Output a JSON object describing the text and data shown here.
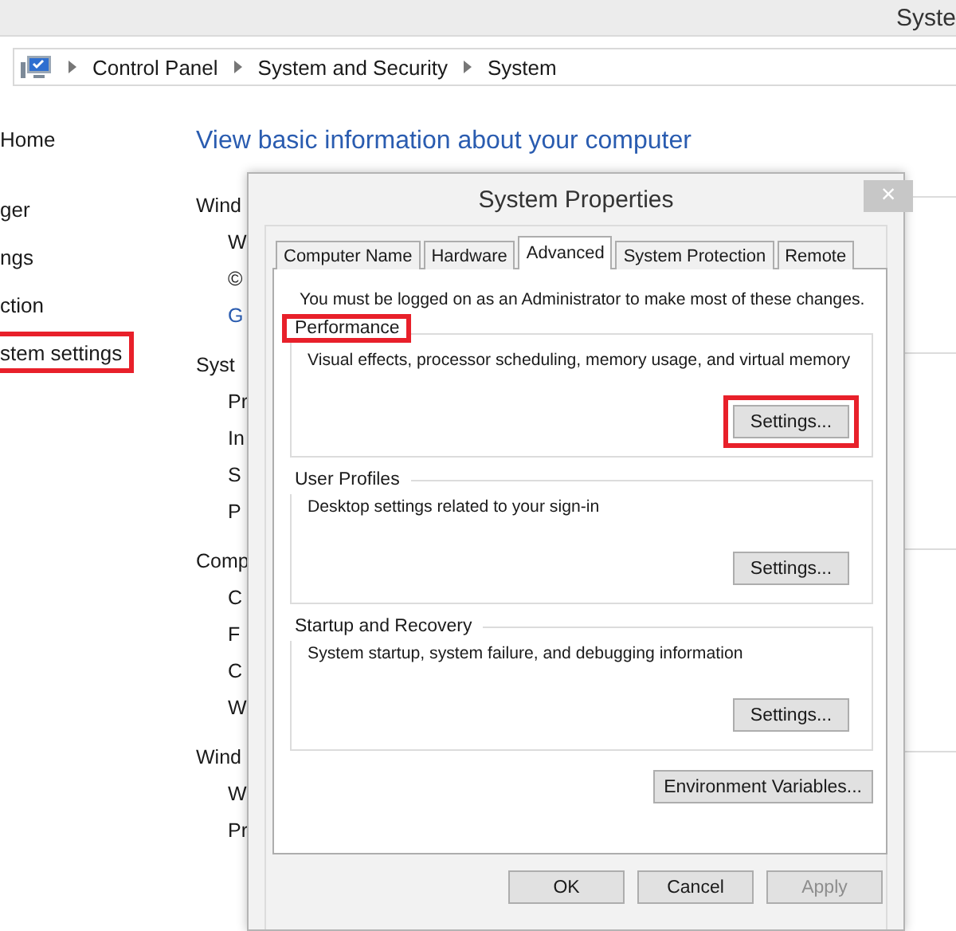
{
  "window": {
    "title": "Syste"
  },
  "breadcrumb": [
    "Control Panel",
    "System and Security",
    "System"
  ],
  "sidebar": {
    "items": [
      {
        "label": "Home",
        "highlighted": false
      },
      {
        "label": "ger",
        "highlighted": false
      },
      {
        "label": "ngs",
        "highlighted": false
      },
      {
        "label": "ction",
        "highlighted": false
      },
      {
        "label": "stem settings",
        "highlighted": true
      }
    ]
  },
  "main": {
    "heading": "View basic information about your computer",
    "lines": [
      {
        "text": "Wind",
        "kind": "heading"
      },
      {
        "text": "W",
        "kind": "item"
      },
      {
        "text": "©",
        "kind": "item"
      },
      {
        "text": "G",
        "kind": "link"
      },
      {
        "text": "Syst",
        "kind": "heading"
      },
      {
        "text": "Pr",
        "kind": "item"
      },
      {
        "text": "In",
        "kind": "item"
      },
      {
        "text": "S",
        "kind": "item"
      },
      {
        "text": "P",
        "kind": "item"
      },
      {
        "text": "Comp",
        "kind": "heading"
      },
      {
        "text": "C",
        "kind": "item"
      },
      {
        "text": "F",
        "kind": "item"
      },
      {
        "text": "C",
        "kind": "item"
      },
      {
        "text": "W",
        "kind": "item"
      },
      {
        "text": "Wind",
        "kind": "heading"
      },
      {
        "text": "W",
        "kind": "item"
      },
      {
        "text": "Pr",
        "kind": "item"
      }
    ]
  },
  "dialog": {
    "title": "System Properties",
    "close": "×",
    "tabs": [
      {
        "label": "Computer Name",
        "selected": false
      },
      {
        "label": "Hardware",
        "selected": false
      },
      {
        "label": "Advanced",
        "selected": true
      },
      {
        "label": "System Protection",
        "selected": false
      },
      {
        "label": "Remote",
        "selected": false
      }
    ],
    "note": "You must be logged on as an Administrator to make most of these changes.",
    "groups": [
      {
        "title": "Performance",
        "description": "Visual effects, processor scheduling, memory usage, and virtual memory",
        "button": "Settings...",
        "highlighted": true
      },
      {
        "title": "User Profiles",
        "description": "Desktop settings related to your sign-in",
        "button": "Settings...",
        "highlighted": false
      },
      {
        "title": "Startup and Recovery",
        "description": "System startup, system failure, and debugging information",
        "button": "Settings...",
        "highlighted": false
      }
    ],
    "extra_button": "Environment Variables...",
    "buttons": [
      {
        "label": "OK",
        "disabled": false
      },
      {
        "label": "Cancel",
        "disabled": false
      },
      {
        "label": "Apply",
        "disabled": true
      }
    ]
  }
}
